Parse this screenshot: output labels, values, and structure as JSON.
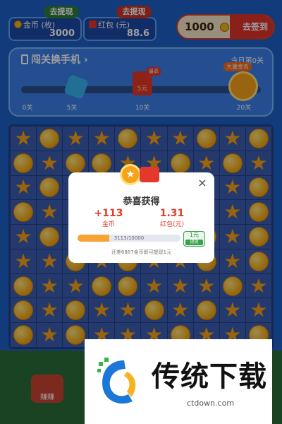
{
  "header": {
    "gold": {
      "tag": "去提现",
      "label": "金币 (枚)",
      "value": "3000"
    },
    "red": {
      "tag": "去提现",
      "label": "红包 (元)",
      "value": "88.6"
    },
    "signin": {
      "amount": "1000",
      "action": "去签到"
    }
  },
  "progress": {
    "title": "闯关换手机",
    "chevron": "›",
    "level": "今日第0关",
    "fill_fraction": 0.0,
    "ticks": [
      "0关",
      "5关",
      "10关",
      "20关"
    ],
    "red_node": {
      "value": "5元",
      "badge": "最高"
    },
    "gold_node": {
      "badge": "大量金币"
    }
  },
  "dialog": {
    "title": "恭喜获得",
    "rewards": [
      {
        "value": "+113",
        "label": "金币"
      },
      {
        "value": "1.31",
        "label": "红包(元)"
      }
    ],
    "progress_text": "3113/10000",
    "progress_fraction": 0.3113,
    "withdraw_amount": "1元",
    "withdraw_label": "提现",
    "hint": "还差6887金币即可提现1元",
    "close": "×"
  },
  "bottom": {
    "earn_label": "赚赚"
  },
  "watermark": {
    "title": "传统下载",
    "url": "ctdown.com"
  },
  "colors": {
    "accent_red": "#e03329",
    "gold": "#f2b31c",
    "panel_blue": "#3a7ee8"
  }
}
